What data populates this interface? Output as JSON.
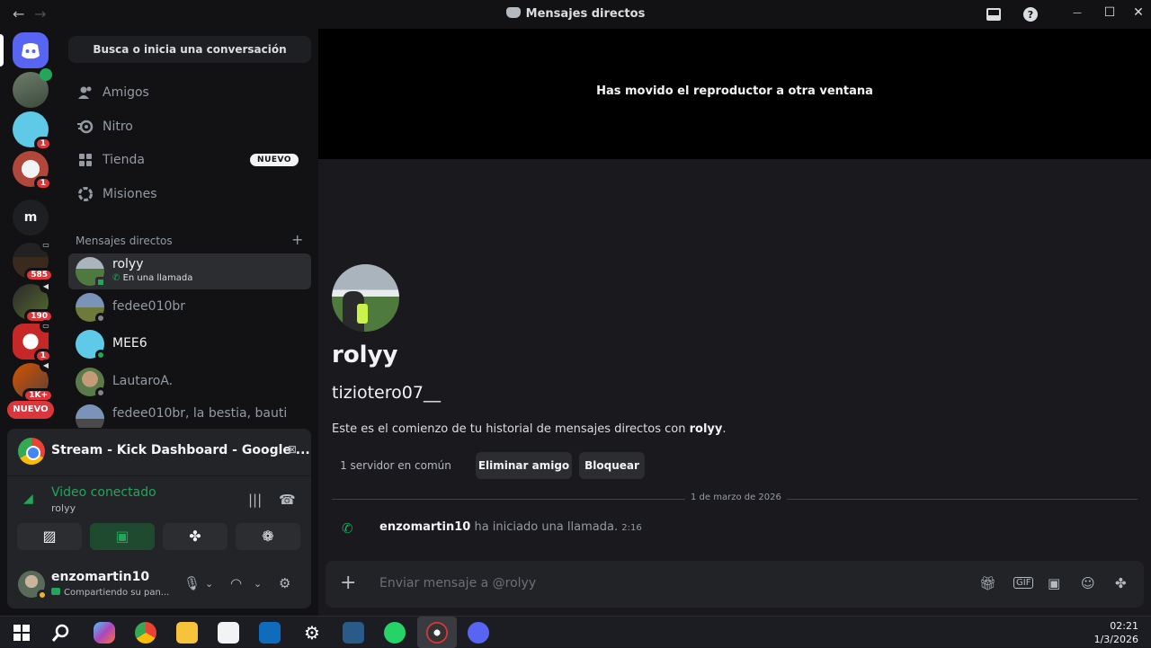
{
  "window": {
    "title": "Mensajes directos",
    "back_glyph": "←",
    "forward_glyph": "→",
    "minimize_glyph": "—",
    "maximize_glyph": "☐",
    "close_glyph": "✕",
    "inbox_icon": "inbox-icon",
    "help_icon": "help-icon"
  },
  "rail": {
    "home_icon": "discord-logo-icon",
    "m_server_label": "m",
    "nuevo_label": "NUEVO",
    "badges": [
      "1",
      "1",
      "585",
      "190",
      "1",
      "1K+"
    ]
  },
  "sidebar": {
    "search_label": "Busca o inicia una conversación",
    "nav": [
      {
        "label": "Amigos",
        "icon": "friends-icon"
      },
      {
        "label": "Nitro",
        "icon": "nitro-icon"
      },
      {
        "label": "Tienda",
        "icon": "shop-icon",
        "tag": "NUEVO"
      },
      {
        "label": "Misiones",
        "icon": "quests-icon"
      }
    ],
    "dm_header": "Mensajes directos",
    "dm_plus": "+",
    "dms": [
      {
        "name": "rolyy",
        "sub": "En una llamada"
      },
      {
        "name": "fedee010br"
      },
      {
        "name": "MEE6"
      },
      {
        "name": "LautaroA."
      },
      {
        "name": "fedee010br, la bestia, bauti"
      }
    ]
  },
  "voice": {
    "stream_title": "Stream - Kick Dashboard - Google ...",
    "status_title": "Video conectado",
    "status_channel": "rolyy"
  },
  "user": {
    "name": "enzomartin10",
    "status": "Compartiendo su pan..."
  },
  "popout": {
    "message": "Has movido el reproductor a otra ventana"
  },
  "chat": {
    "display_name": "rolyy",
    "username": "tiziotero07__",
    "intro_prefix": "Este es el comienzo de tu historial de mensajes directos con ",
    "intro_name": "rolyy",
    "intro_suffix": ".",
    "mutual_servers": "1 servidor en común",
    "remove_friend": "Eliminar amigo",
    "block": "Bloquear",
    "date": "1 de marzo de 2026",
    "call_user": "enzomartin10",
    "call_text": " ha iniciado una llamada. ",
    "call_time": "2:16",
    "composer_placeholder": "Enviar mensaje a @rolyy",
    "composer_plus": "+"
  },
  "taskbar": {
    "time": "02:21",
    "date": "1/3/2026"
  },
  "colors": {
    "accent": "#5865f2",
    "online": "#23a55a",
    "badge": "#da373c",
    "idle": "#f0b232"
  }
}
